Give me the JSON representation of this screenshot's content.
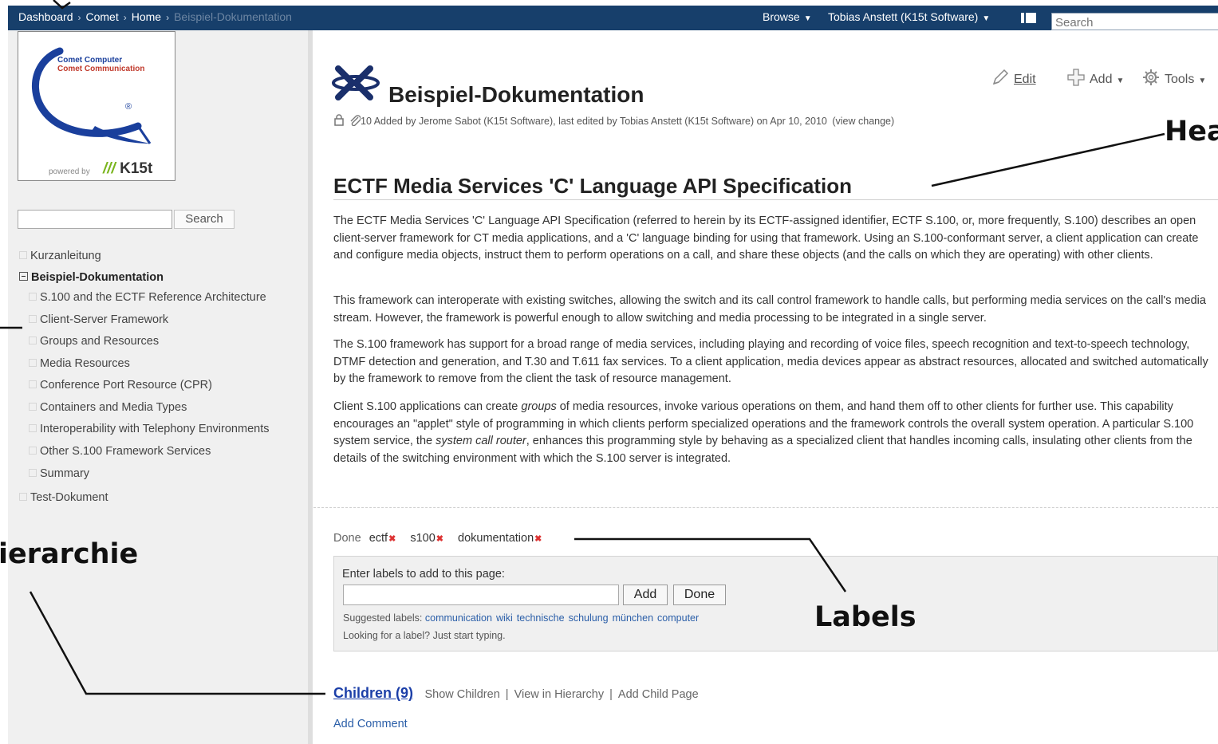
{
  "breadcrumb": {
    "items": [
      "Dashboard",
      "Comet",
      "Home"
    ],
    "current": "Beispiel-Dokumentation",
    "separator": "›"
  },
  "header": {
    "browse_label": "Browse",
    "user_label": "Tobias Anstett (K15t Software)",
    "search_placeholder": "Search",
    "caret": "▼"
  },
  "logo": {
    "line1": "Comet Computer",
    "line2": "Comet Communication",
    "registered": "®",
    "powered_by": "powered by",
    "k15t_slashes": "///",
    "k15t_brand": "K15t"
  },
  "sidebar": {
    "search_button": "Search",
    "tree": [
      {
        "label": "Kurzanleitung"
      },
      {
        "label": "Beispiel-Dokumentation"
      },
      {
        "label": "S.100 and the ECTF Reference Architecture"
      },
      {
        "label": "Client-Server Framework"
      },
      {
        "label": "Groups and Resources"
      },
      {
        "label": "Media Resources"
      },
      {
        "label": "Conference Port Resource (CPR)"
      },
      {
        "label": "Containers and Media Types"
      },
      {
        "label": "Interoperability with Telephony Environments"
      },
      {
        "label": "Other S.100 Framework Services"
      },
      {
        "label": "Summary"
      },
      {
        "label": "Test-Dokument"
      }
    ]
  },
  "page": {
    "title": "Beispiel-Dokumentation",
    "meta_count": "10",
    "meta_text": "Added by Jerome Sabot (K15t Software), last edited by Tobias Anstett (K15t Software) on Apr 10, 2010",
    "view_change": "(view change)",
    "edit_label": "Edit",
    "add_label": "Add",
    "tools_label": "Tools"
  },
  "content": {
    "heading": "ECTF Media Services 'C' Language API Specification",
    "p1": "The ECTF Media Services 'C' Language API Specification (referred to herein by its ECTF-assigned identifier, ECTF S.100, or, more frequently, S.100) describes an open client-server framework for CT media applications, and a 'C' language binding for using that framework. Using an S.100-conformant server, a client application can create and configure media objects, instruct them to perform operations on a call, and share these objects (and the calls on which they are operating) with other clients.",
    "p2": "This framework can interoperate with existing switches, allowing the switch and its call control framework to handle calls, but performing media services on the call's media stream. However, the framework is powerful enough to allow switching and media processing to be integrated in a single server.",
    "p3": "The S.100 framework has support for a broad range of media services, including playing and recording of voice files, speech recognition and text-to-speech technology, DTMF detection and generation, and T.30 and T.611 fax services. To a client application, media devices appear as abstract resources, allocated and switched automatically by the framework to remove from the client the task of resource management.",
    "p4_a": "Client S.100 applications can create ",
    "p4_em1": "groups",
    "p4_b": " of media resources, invoke various operations on them, and hand them off to other clients for further use. This capability encourages an \"applet\" style of programming in which clients perform specialized operations and the framework controls the overall system operation. A particular S.100 system service, the ",
    "p4_em2": "system call router",
    "p4_c": ", enhances this programming style by behaving as a specialized client that handles incoming calls, insulating other clients from the details of the switching environment with which the S.100 server is integrated."
  },
  "labels": {
    "done_label": "Done",
    "remove_glyph": "✖",
    "items": [
      "ectf",
      "s100",
      "dokumentation"
    ],
    "prompt": "Enter labels to add to this page:",
    "add_button": "Add",
    "done_button": "Done",
    "suggested_prefix": "Suggested labels:",
    "suggested": [
      "communication",
      "wiki",
      "technische",
      "schulung",
      "münchen",
      "computer"
    ],
    "hint": "Looking for a label? Just start typing."
  },
  "children": {
    "link": "Children (9)",
    "show": "Show Children",
    "view": "View in Hierarchy",
    "add_child": "Add Child Page",
    "separator": "|",
    "add_comment": "Add Comment"
  },
  "annotations": {
    "heading": "Hea",
    "hierarchy": "ierarchie",
    "labels": "Labels"
  }
}
